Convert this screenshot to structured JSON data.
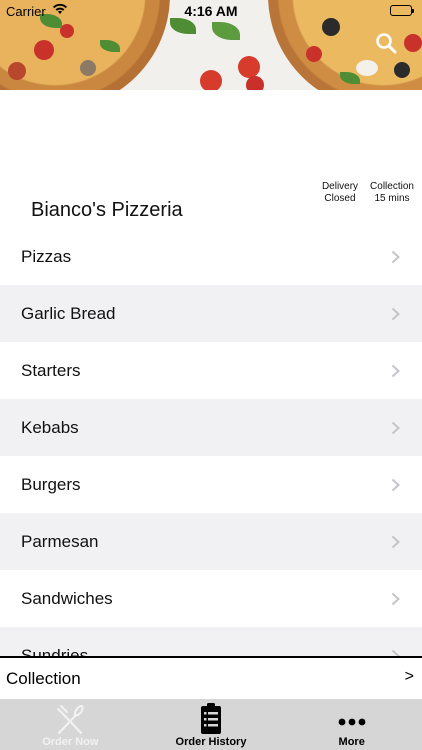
{
  "status_bar": {
    "carrier": "Carrier",
    "time": "4:16 AM"
  },
  "restaurant": {
    "name": "Bianco's Pizzeria",
    "delivery_label": "Delivery",
    "delivery_status": "Closed",
    "collection_label": "Collection",
    "collection_time": "15 mins"
  },
  "categories": [
    {
      "label": "Pizzas"
    },
    {
      "label": "Garlic Bread"
    },
    {
      "label": "Starters"
    },
    {
      "label": "Kebabs"
    },
    {
      "label": "Burgers"
    },
    {
      "label": "Parmesan"
    },
    {
      "label": "Sandwiches"
    },
    {
      "label": "Sundries"
    }
  ],
  "order_mode": {
    "label": "Collection",
    "arrow": ">"
  },
  "tabs": [
    {
      "label": "Order Now",
      "icon": "fork-knife-icon",
      "active": true
    },
    {
      "label": "Order History",
      "icon": "receipt-icon",
      "active": false
    },
    {
      "label": "More",
      "icon": "more-dots-icon",
      "active": false
    }
  ],
  "colors": {
    "row_alt": "#f1f1f4",
    "tabbar": "#d6d6d6",
    "active_tab_label": "#f2f2f2"
  }
}
